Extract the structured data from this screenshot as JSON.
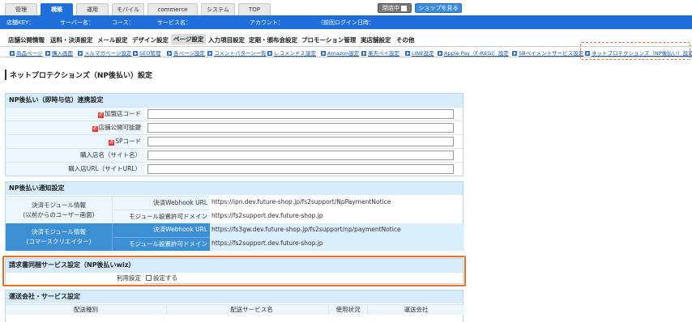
{
  "top_tabs": [
    "管理",
    "構築",
    "運用",
    "モバイル",
    "commerce creator",
    "システム",
    "TOP"
  ],
  "top_buttons": {
    "closed": "閉店中",
    "shop": "ショップを見る"
  },
  "info_bar": {
    "shop_key_label": "店舗KEY：",
    "server_label": "サーバー名：",
    "course_label": "コース：",
    "service_label": "サービス名：",
    "account_label": "アカウント：",
    "last_login_label": "（前回ログイン日時："
  },
  "main_menu": [
    "店舗公開情報",
    "送料・決済設定",
    "メール設定",
    "デザイン設定",
    "ページ設定",
    "入力項目設定",
    "定期・頒布会設定",
    "プロモーション管理",
    "実店舗設定",
    "その他"
  ],
  "sub_menu": [
    "商品ページ",
    "購入画面",
    "メルマガページ設定",
    "SEO管理",
    "各ページ設定",
    "コメントパターン一覧",
    "レコメンド２設定",
    "Amazon設定",
    "楽天ペイ設定",
    "LINE設定",
    "Apple Pay（F-REGI）設定",
    "SBペイメントサービス設定",
    "ネットプロテクションズ（NP後払い）設定"
  ],
  "page_title": "ネットプロテクションズ（NP後払い）設定",
  "section1": {
    "title": "NP後払い（即時与信）連携設定",
    "fields": [
      {
        "label": "加盟店コード",
        "required": true,
        "value": ""
      },
      {
        "label": "店舗公開可能鍵",
        "required": true,
        "value": ""
      },
      {
        "label": "SPコード",
        "required": true,
        "value": ""
      },
      {
        "label": "購入店名（サイト名）",
        "required": false,
        "value": ""
      },
      {
        "label": "購入店URL（サイトURL）",
        "required": false,
        "value": ""
      }
    ]
  },
  "section2": {
    "title": "NP後払い通知設定",
    "group1_label_line1": "決済モジュール情報",
    "group1_label_line2": "(以前からのユーザー画面)",
    "group2_label_line1": "決済モジュール情報",
    "group2_label_line2": "(コマースクリエイター)",
    "webhook_label": "決済Webhook URL",
    "domain_label": "モジュール設置許可ドメイン",
    "group1_webhook": "https://ipn.dev.future-shop.jp/fs2support/NpPaymentNotice",
    "group1_domain": "https://fs2support.dev.future-shop.jp",
    "group2_webhook": "https://fs3gw.dev.future-shop.jp/fs2support/np/paymentNotice",
    "group2_domain": "https://fs2support.dev.future-shop.jp"
  },
  "section3": {
    "title": "請求書同梱サービス設定（NP後払いwiz）",
    "usage_label": "利用設定",
    "checkbox_label": "設定する"
  },
  "section4": {
    "title": "運送会社・サービス設定",
    "columns": [
      "配送種別",
      "配送サービス名",
      "使用状況",
      "運送会社"
    ]
  }
}
